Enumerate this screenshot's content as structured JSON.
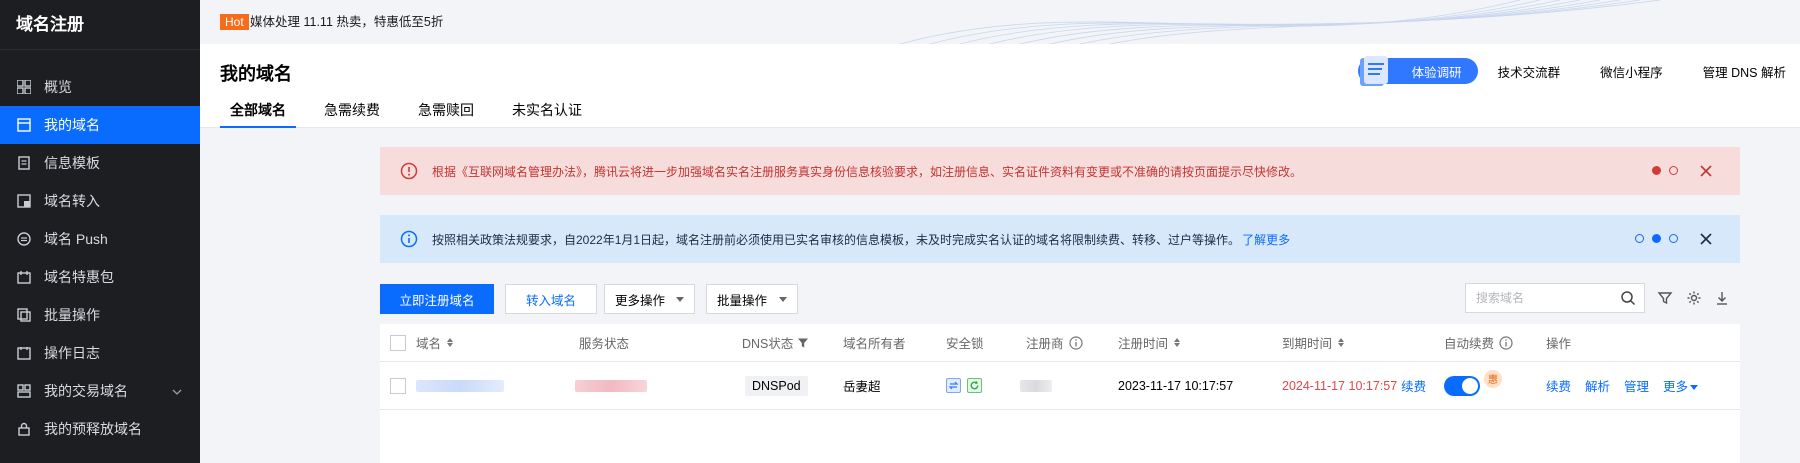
{
  "sidebar": {
    "brand": "域名注册",
    "items": [
      {
        "label": "概览",
        "icon": "grid-icon"
      },
      {
        "label": "我的域名",
        "icon": "calendar-icon",
        "active": true
      },
      {
        "label": "信息模板",
        "icon": "document-icon"
      },
      {
        "label": "域名转入",
        "icon": "transfer-icon"
      },
      {
        "label": "域名 Push",
        "icon": "push-icon"
      },
      {
        "label": "域名特惠包",
        "icon": "gift-icon"
      },
      {
        "label": "批量操作",
        "icon": "copy-icon"
      },
      {
        "label": "操作日志",
        "icon": "log-icon"
      },
      {
        "label": "我的交易域名",
        "icon": "trade-icon",
        "expandable": true
      },
      {
        "label": "我的预释放域名",
        "icon": "lock-icon"
      }
    ]
  },
  "topbar": {
    "hot_badge": "Hot",
    "promo": "媒体处理 11.11 热卖，特惠低至5折"
  },
  "header": {
    "title": "我的域名",
    "tabs": [
      "全部域名",
      "急需续费",
      "急需赎回",
      "未实名认证"
    ],
    "active_tab": 0,
    "survey_label": "体验调研",
    "links": [
      "技术交流群",
      "微信小程序",
      "管理 DNS 解析"
    ]
  },
  "alerts": {
    "error_text": "根据《互联网域名管理办法》，腾讯云将进一步加强域名实名注册服务真实身份信息核验要求，如注册信息、实名证件资料有变更或不准确的请按页面提示尽快修改。",
    "info_text": "按照相关政策法规要求，自2022年1月1日起，域名注册前必须使用已实名审核的信息模板，未及时完成实名认证的域名将限制续费、转移、过户等操作。",
    "info_link": "了解更多"
  },
  "toolbar": {
    "register_button": "立即注册域名",
    "transfer_button": "转入域名",
    "more_ops": "更多操作",
    "batch_ops": "批量操作",
    "search_placeholder": "搜索域名"
  },
  "table": {
    "columns": [
      "域名",
      "服务状态",
      "DNS状态",
      "域名所有者",
      "安全锁",
      "注册商",
      "注册时间",
      "到期时间",
      "自动续费",
      "操作"
    ],
    "rows": [
      {
        "dns_status": "DNSPod",
        "owner": "岳妻超",
        "registered": "2023-11-17 10:17:57",
        "expires": "2024-11-17 10:17:57",
        "renew_link": "续费",
        "auto_renew": true,
        "badge": "惠",
        "actions": [
          "续费",
          "解析",
          "管理",
          "更多"
        ]
      }
    ]
  },
  "colors": {
    "accent": "#0a6cff",
    "sidebar_bg": "#1d1e22",
    "error_bg": "#f7dcdc",
    "info_bg": "#d8e8fb",
    "expire_red": "#e54545"
  }
}
